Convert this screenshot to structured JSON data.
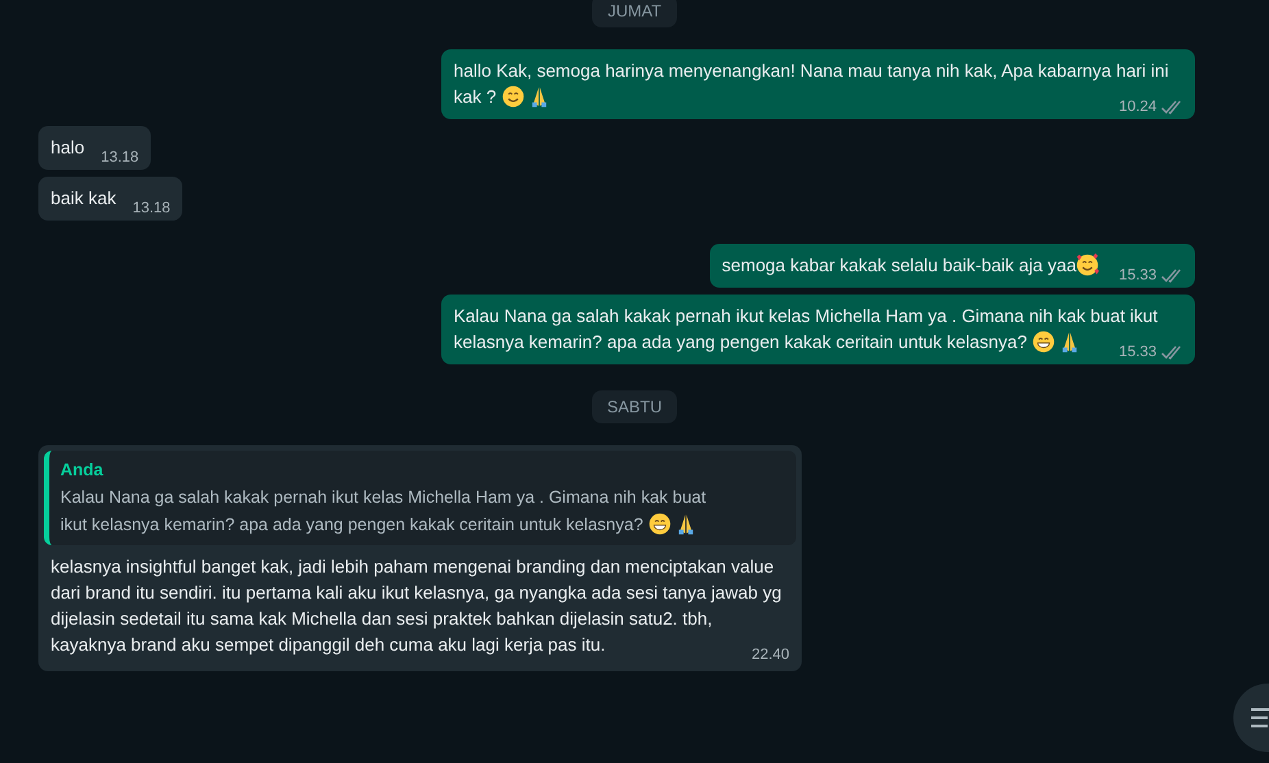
{
  "messages": [
    {
      "kind": "date",
      "label": "JUMAT"
    },
    {
      "kind": "outgoing",
      "text": "hallo Kak,  semoga harinya menyenangkan! Nana mau tanya nih kak, Apa kabarnya hari ini kak ? ",
      "emojis": [
        {
          "kind": "smile"
        },
        {
          "kind": "pray"
        }
      ],
      "time": "10.24",
      "delivered": true
    },
    {
      "kind": "incoming",
      "text": "halo",
      "time": "13.18"
    },
    {
      "kind": "incoming",
      "text": "baik kak",
      "time": "13.18"
    },
    {
      "kind": "outgoing",
      "text": "semoga kabar kakak selalu baik-baik aja yaa",
      "emojis": [
        {
          "kind": "hearts"
        }
      ],
      "time": "15.33",
      "delivered": true
    },
    {
      "kind": "outgoing",
      "text": "Kalau Nana ga salah kakak pernah ikut kelas  Michella Ham ya . Gimana nih kak buat ikut kelasnya kemarin? apa ada yang pengen kakak ceritain untuk kelasnya? ",
      "emojis": [
        {
          "kind": "grin"
        },
        {
          "kind": "pray"
        }
      ],
      "time": "15.33",
      "delivered": true
    },
    {
      "kind": "date",
      "label": "SABTU"
    },
    {
      "kind": "incoming",
      "quote": {
        "author": "Anda",
        "text": "Kalau Nana ga salah kakak pernah ikut kelas  Michella Ham ya . Gimana nih kak buat ikut kelasnya kemarin? apa ada yang pengen kakak ceritain untuk kelasnya? ",
        "emojis": [
          {
            "kind": "grin"
          },
          {
            "kind": "pray"
          }
        ]
      },
      "text": "kelasnya insightful banget kak, jadi lebih paham mengenai branding dan menciptakan value dari brand itu sendiri. itu pertama kali aku ikut kelasnya, ga nyangka ada sesi tanya jawab yg dijelasin sedetail itu sama kak Michella dan sesi praktek bahkan dijelasin satu2. tbh, kayaknya brand aku sempet dipanggil deh cuma aku lagi kerja pas itu.",
      "time": "22.40"
    }
  ]
}
